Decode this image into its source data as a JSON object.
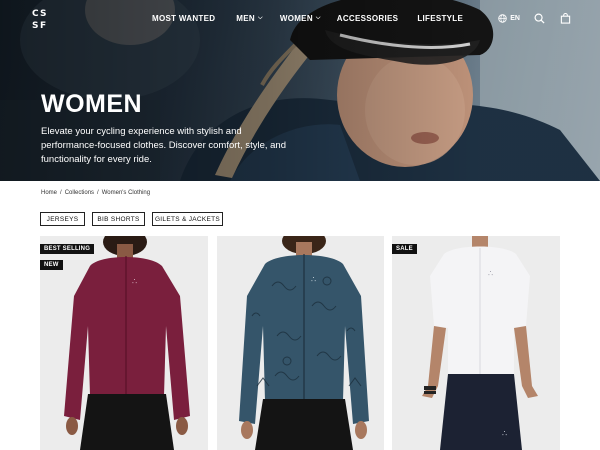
{
  "nav": {
    "logo_text": "CS\nSF",
    "links": [
      {
        "label": "MOST WANTED",
        "has_dropdown": false
      },
      {
        "label": "MEN",
        "has_dropdown": true
      },
      {
        "label": "WOMEN",
        "has_dropdown": true
      },
      {
        "label": "ACCESSORIES",
        "has_dropdown": false
      },
      {
        "label": "LIFESTYLE",
        "has_dropdown": false
      }
    ],
    "language": "EN",
    "icons": [
      "globe-icon",
      "search-icon",
      "bag-icon"
    ]
  },
  "hero": {
    "title": "WOMEN",
    "description": "Elevate your cycling experience with stylish and performance-focused clothes. Discover comfort, style, and functionality for every ride."
  },
  "breadcrumb": {
    "items": [
      "Home",
      "Collections",
      "Women's Clothing"
    ],
    "separator": "/"
  },
  "filters": [
    "JERSEYS",
    "BIB SHORTS",
    "GILETS & JACKETS"
  ],
  "products": [
    {
      "badges": [
        "BEST SELLING",
        "NEW"
      ],
      "jersey_color": "#7a1f3d",
      "shorts_color": "#141414",
      "style": "long-sleeve"
    },
    {
      "badges": [],
      "jersey_color": "#35556a",
      "shorts_color": "#141414",
      "style": "long-sleeve-print"
    },
    {
      "badges": [
        "SALE"
      ],
      "jersey_color": "#f4f4f6",
      "shorts_color": "#1c2233",
      "style": "short-sleeve"
    }
  ],
  "colors": {
    "badge_bg": "#111111",
    "card_bg": "#ececec",
    "text": "#111111"
  }
}
